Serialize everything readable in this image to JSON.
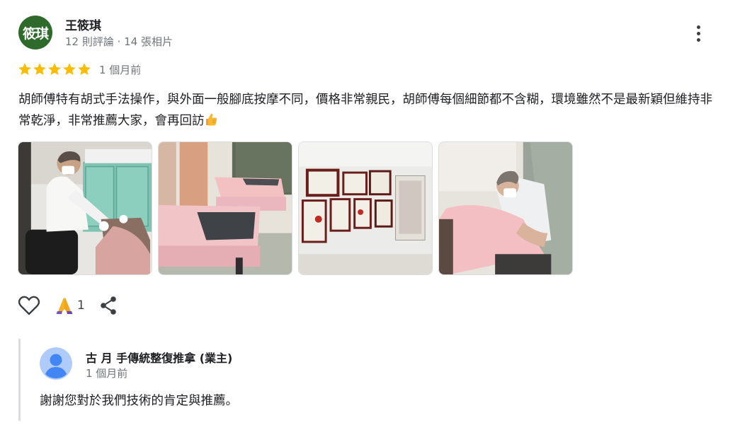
{
  "review": {
    "author": {
      "avatar_text": "筱琪",
      "avatar_color": "#2e6b2a",
      "name": "王筱琪",
      "meta": "12 則評論 · 14 張相片"
    },
    "more_icon": "more-vert-icon",
    "rating": 5,
    "star_color": "#fbbc04",
    "time": "1 個月前",
    "text": "胡師傅特有胡式手法操作，與外面一般腳底按摩不同，價格非常親民，胡師傅每個細節都不含糊，環境雖然不是最新穎但維持非常乾淨，非常推薦大家，會再回訪",
    "text_emoji": "thumbs-up-emoji",
    "photos": [
      {
        "description": "therapist-massaging-foot"
      },
      {
        "description": "massage-room-tables"
      },
      {
        "description": "certificates-wall"
      },
      {
        "description": "therapist-massaging-back"
      }
    ],
    "actions": {
      "like_icon": "heart-outline-icon",
      "reaction_icon": "praying-hands-emoji",
      "reaction_count": "1",
      "share_icon": "share-icon"
    }
  },
  "owner_reply": {
    "name": "古 月 手傳統整復推拿 (業主)",
    "time": "1 個月前",
    "text": "謝謝您對於我們技術的肯定與推薦。",
    "avatar_icon": "default-person-avatar"
  }
}
